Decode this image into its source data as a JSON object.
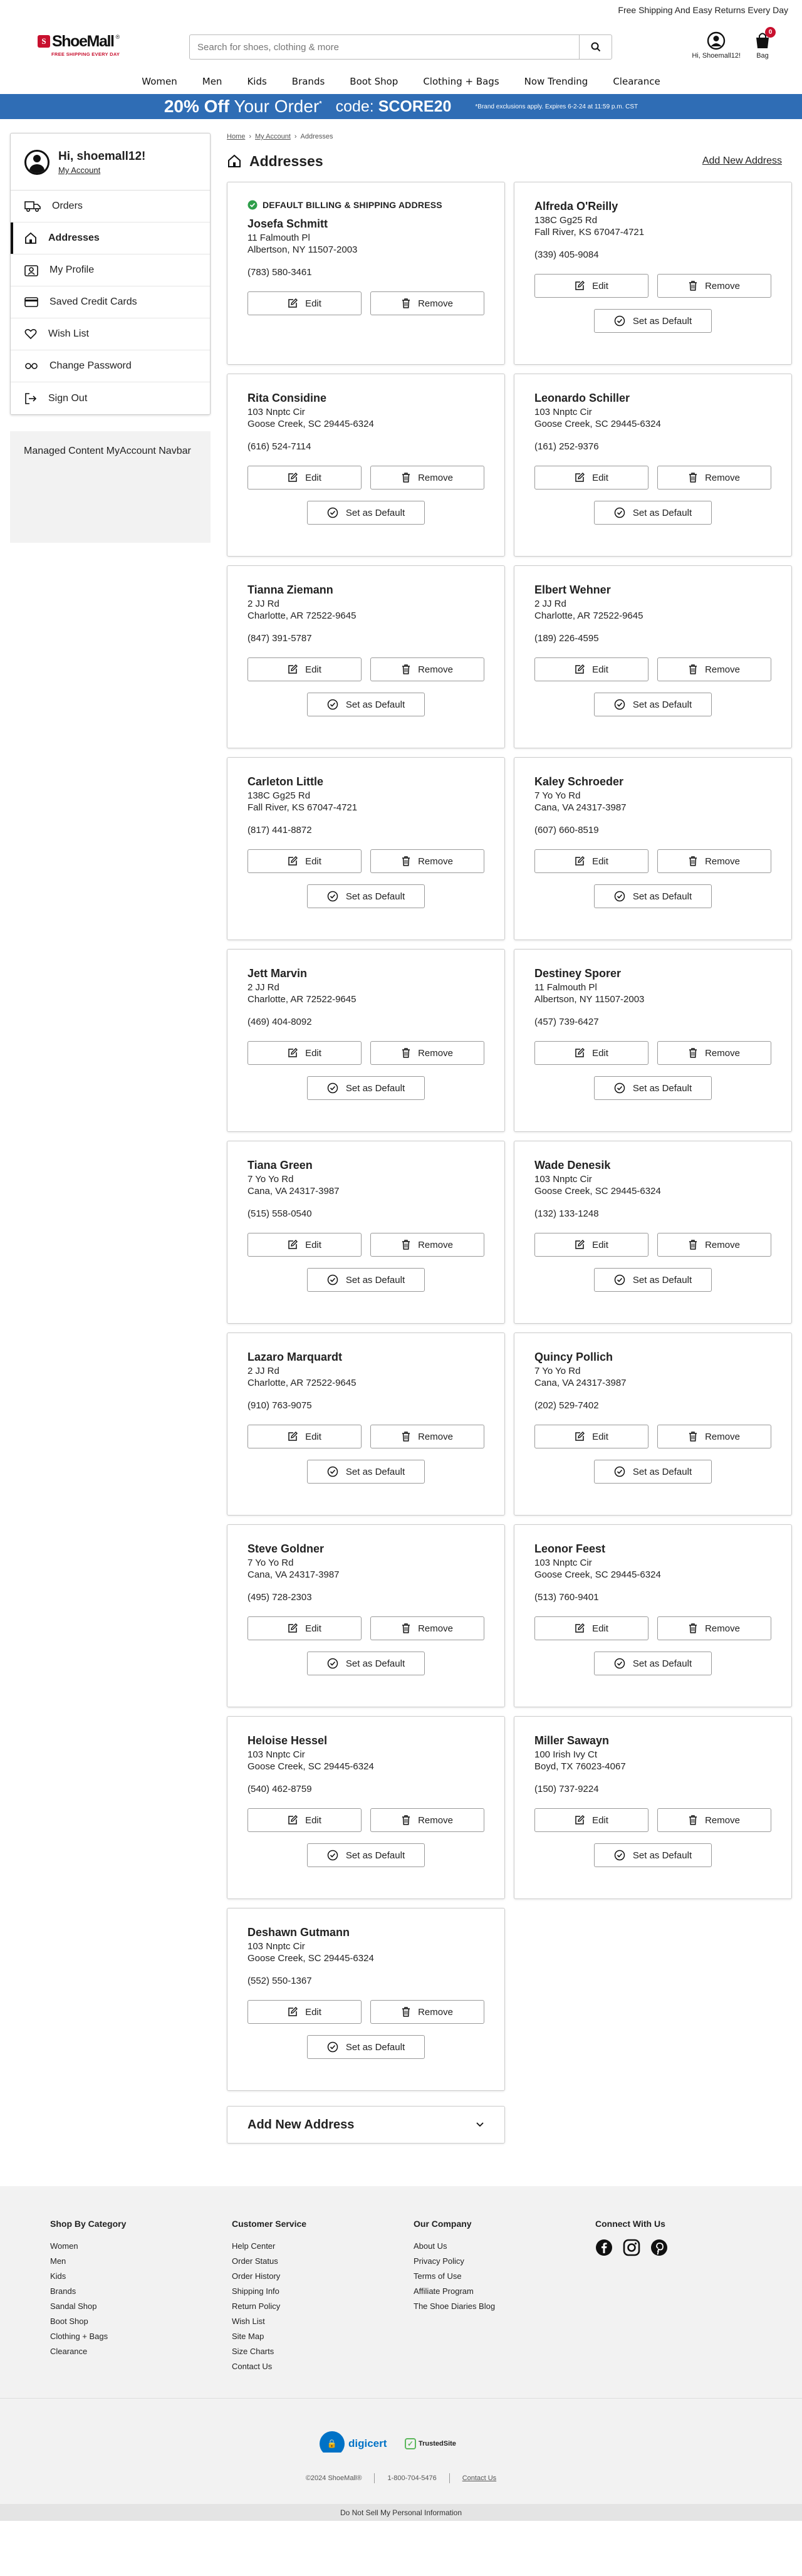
{
  "topbar": {
    "text": "Free Shipping And Easy Returns Every Day"
  },
  "logo": {
    "text": "ShoeMall",
    "tagline": "FREE SHIPPING EVERY DAY"
  },
  "search": {
    "placeholder": "Search for shoes, clothing & more"
  },
  "header": {
    "account_label": "Hi, Shoemall12!",
    "bag_label": "Bag",
    "bag_count": "0"
  },
  "nav": {
    "items": [
      "Women",
      "Men",
      "Kids",
      "Brands",
      "Boot Shop",
      "Clothing + Bags",
      "Now Trending",
      "Clearance"
    ]
  },
  "promo": {
    "headline_bold": "20% Off",
    "headline_rest": " Your Order",
    "code_label": "code:",
    "code": "SCORE20",
    "fine_print": "*Brand exclusions apply. Expires 6-2-24 at 11:59 p.m. CST"
  },
  "sidebar": {
    "greeting": "Hi, shoemall12!",
    "my_account": "My Account",
    "items": [
      {
        "label": "Orders"
      },
      {
        "label": "Addresses"
      },
      {
        "label": "My Profile"
      },
      {
        "label": "Saved Credit Cards"
      },
      {
        "label": "Wish List"
      },
      {
        "label": "Change Password"
      },
      {
        "label": "Sign Out"
      }
    ],
    "managed": "Managed Content MyAccount Navbar"
  },
  "breadcrumb": {
    "home": "Home",
    "account": "My Account",
    "current": "Addresses"
  },
  "page": {
    "title": "Addresses",
    "add_new_link": "Add New Address",
    "default_tag": "DEFAULT BILLING & SHIPPING ADDRESS",
    "add_new_panel": "Add New Address"
  },
  "buttons": {
    "edit": "Edit",
    "remove": "Remove",
    "set_default": "Set as Default"
  },
  "addresses": [
    {
      "name": "Josefa Schmitt",
      "line1": "11 Falmouth Pl",
      "line2": "Albertson, NY 11507-2003",
      "phone": "(783) 580-3461",
      "is_default": true
    },
    {
      "name": "Alfreda O'Reilly",
      "line1": "138C Gg25 Rd",
      "line2": "Fall River, KS 67047-4721",
      "phone": "(339) 405-9084",
      "is_default": false
    },
    {
      "name": "Rita Considine",
      "line1": "103 Nnptc Cir",
      "line2": "Goose Creek, SC 29445-6324",
      "phone": "(616) 524-7114",
      "is_default": false
    },
    {
      "name": "Leonardo Schiller",
      "line1": "103 Nnptc Cir",
      "line2": "Goose Creek, SC 29445-6324",
      "phone": "(161) 252-9376",
      "is_default": false
    },
    {
      "name": "Tianna Ziemann",
      "line1": "2 JJ Rd",
      "line2": "Charlotte, AR 72522-9645",
      "phone": "(847) 391-5787",
      "is_default": false
    },
    {
      "name": "Elbert Wehner",
      "line1": "2 JJ Rd",
      "line2": "Charlotte, AR 72522-9645",
      "phone": "(189) 226-4595",
      "is_default": false
    },
    {
      "name": "Carleton Little",
      "line1": "138C Gg25 Rd",
      "line2": "Fall River, KS 67047-4721",
      "phone": "(817) 441-8872",
      "is_default": false
    },
    {
      "name": "Kaley Schroeder",
      "line1": "7 Yo Yo Rd",
      "line2": "Cana, VA 24317-3987",
      "phone": "(607) 660-8519",
      "is_default": false
    },
    {
      "name": "Jett Marvin",
      "line1": "2 JJ Rd",
      "line2": "Charlotte, AR 72522-9645",
      "phone": "(469) 404-8092",
      "is_default": false
    },
    {
      "name": "Destiney Sporer",
      "line1": "11 Falmouth Pl",
      "line2": "Albertson, NY 11507-2003",
      "phone": "(457) 739-6427",
      "is_default": false
    },
    {
      "name": "Tiana Green",
      "line1": "7 Yo Yo Rd",
      "line2": "Cana, VA 24317-3987",
      "phone": "(515) 558-0540",
      "is_default": false
    },
    {
      "name": "Wade Denesik",
      "line1": "103 Nnptc Cir",
      "line2": "Goose Creek, SC 29445-6324",
      "phone": "(132) 133-1248",
      "is_default": false
    },
    {
      "name": "Lazaro Marquardt",
      "line1": "2 JJ Rd",
      "line2": "Charlotte, AR 72522-9645",
      "phone": "(910) 763-9075",
      "is_default": false
    },
    {
      "name": "Quincy Pollich",
      "line1": "7 Yo Yo Rd",
      "line2": "Cana, VA 24317-3987",
      "phone": "(202) 529-7402",
      "is_default": false
    },
    {
      "name": "Steve Goldner",
      "line1": "7 Yo Yo Rd",
      "line2": "Cana, VA 24317-3987",
      "phone": "(495) 728-2303",
      "is_default": false
    },
    {
      "name": "Leonor Feest",
      "line1": "103 Nnptc Cir",
      "line2": "Goose Creek, SC 29445-6324",
      "phone": "(513) 760-9401",
      "is_default": false
    },
    {
      "name": "Heloise Hessel",
      "line1": "103 Nnptc Cir",
      "line2": "Goose Creek, SC 29445-6324",
      "phone": "(540) 462-8759",
      "is_default": false
    },
    {
      "name": "Miller Sawayn",
      "line1": "100 Irish Ivy Ct",
      "line2": "Boyd, TX 76023-4067",
      "phone": "(150) 737-9224",
      "is_default": false
    },
    {
      "name": "Deshawn Gutmann",
      "line1": "103 Nnptc Cir",
      "line2": "Goose Creek, SC 29445-6324",
      "phone": "(552) 550-1367",
      "is_default": false
    }
  ],
  "footer": {
    "columns": [
      {
        "title": "Shop By Category",
        "links": [
          "Women",
          "Men",
          "Kids",
          "Brands",
          "Sandal Shop",
          "Boot Shop",
          "Clothing + Bags",
          "Clearance"
        ]
      },
      {
        "title": "Customer Service",
        "links": [
          "Help Center",
          "Order Status",
          "Order History",
          "Shipping Info",
          "Return Policy",
          "Wish List",
          "Site Map",
          "Size Charts",
          "Contact Us"
        ]
      },
      {
        "title": "Our Company",
        "links": [
          "About Us",
          "Privacy Policy",
          "Terms of Use",
          "Affiliate Program",
          "The Shoe Diaries Blog"
        ]
      }
    ],
    "connect_title": "Connect With Us",
    "digicert": "digicert",
    "trusted": "TrustedSite",
    "copyright": "©2024 ShoeMall®",
    "phone": "1-800-704-5476",
    "contact": "Contact Us",
    "dns": "Do Not Sell My Personal Information"
  },
  "colors": {
    "brand_red": "#c8102e",
    "promo_blue": "#2f6db5",
    "default_green": "#2e9e4a"
  }
}
